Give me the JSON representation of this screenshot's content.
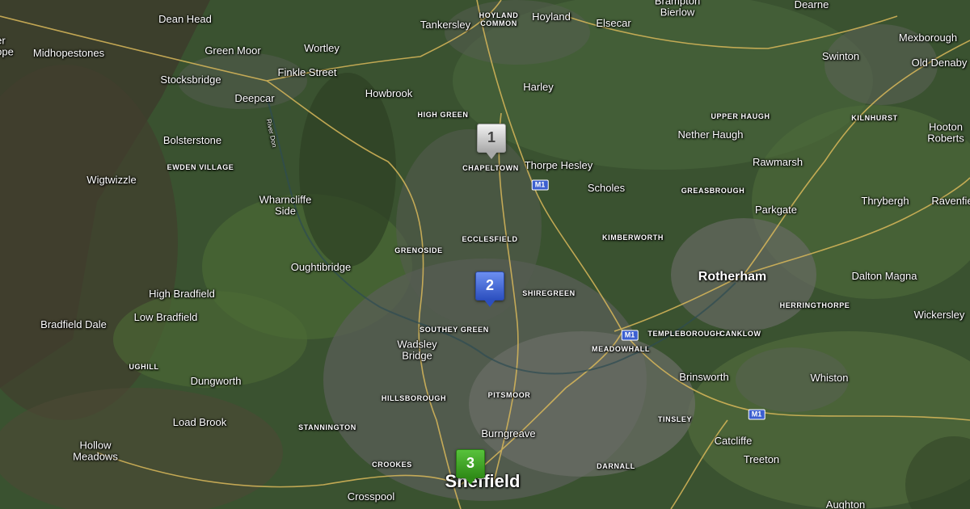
{
  "map": {
    "type": "satellite",
    "road_color": "#e8c25a",
    "marker_colors": {
      "gray": "#b8b8b8",
      "blue": "#3558d4",
      "green": "#3aa020"
    },
    "markers": [
      {
        "label": "1",
        "color": "gray"
      },
      {
        "label": "2",
        "color": "blue"
      },
      {
        "label": "3",
        "color": "green"
      }
    ],
    "labels": {
      "dean_head": "Dean Head",
      "tankersley": "Tankersley",
      "hoyland_common": "HOYLAND\nCOMMON",
      "hoyland": "Hoyland",
      "elsecar": "Elsecar",
      "brampton_bierlow": "Brampton\nBierlow",
      "dearne": "Dearne",
      "mexborough": "Mexborough",
      "er_ope": "er\nope",
      "midhopestones": "Midhopestones",
      "green_moor": "Green Moor",
      "wortley": "Wortley",
      "swinton": "Swinton",
      "old_denaby": "Old Denaby",
      "stocksbridge": "Stocksbridge",
      "finkle_street": "Finkle Street",
      "harley": "Harley",
      "deepcar": "Deepcar",
      "howbrook": "Howbrook",
      "high_green": "HIGH GREEN",
      "upper_haugh": "UPPER HAUGH",
      "kilnhurst": "KILNHURST",
      "hooton_roberts": "Hooton\nRoberts",
      "bolsterstone": "Bolsterstone",
      "nether_haugh": "Nether Haugh",
      "ewden_village": "EWDEN VILLAGE",
      "chapeltown": "CHAPELTOWN",
      "thorpe_hesley": "Thorpe Hesley",
      "rawmarsh": "Rawmarsh",
      "wigtwizzle": "Wigtwizzle",
      "scholes": "Scholes",
      "greasbrough": "GREASBROUGH",
      "thrybergh": "Thrybergh",
      "ravenfield": "Ravenfie",
      "wharncliffe_side": "Wharncliffe\nSide",
      "parkgate": "Parkgate",
      "ecclesfield": "ECCLESFIELD",
      "kimberworth": "KIMBERWORTH",
      "grenoside": "GRENOSIDE",
      "oughtibridge": "Oughtibridge",
      "rotherham": "Rotherham",
      "dalton_magna": "Dalton Magna",
      "shiregreen": "SHIREGREEN",
      "high_bradfield": "High Bradfield",
      "herringthorpe": "HERRINGTHORPE",
      "low_bradfield": "Low Bradfield",
      "wickersley": "Wickersley",
      "bradfield_dale": "Bradfield Dale",
      "southey_green": "SOUTHEY GREEN",
      "templeborough": "TEMPLEBOROUGH",
      "canklow": "CANKLOW",
      "wadsley_bridge": "Wadsley\nBridge",
      "meadowhall": "MEADOWHALL",
      "ughill": "UGHILL",
      "brinsworth": "Brinsworth",
      "whiston": "Whiston",
      "dungworth": "Dungworth",
      "hillsborough": "HILLSBOROUGH",
      "pitsmoor": "PITSMOOR",
      "load_brook": "Load Brook",
      "stannington": "STANNINGTON",
      "tinsley": "TINSLEY",
      "burngreave": "Burngreave",
      "catcliffe": "Catcliffe",
      "hollow_meadows": "Hollow\nMeadows",
      "treeton": "Treeton",
      "crookes": "CROOKES",
      "darnall": "DARNALL",
      "sheffield": "Sheffield",
      "crosspool": "Crosspool",
      "aughton": "Aughton",
      "river_don": "River Don"
    },
    "roads": {
      "m1": "M1"
    }
  }
}
